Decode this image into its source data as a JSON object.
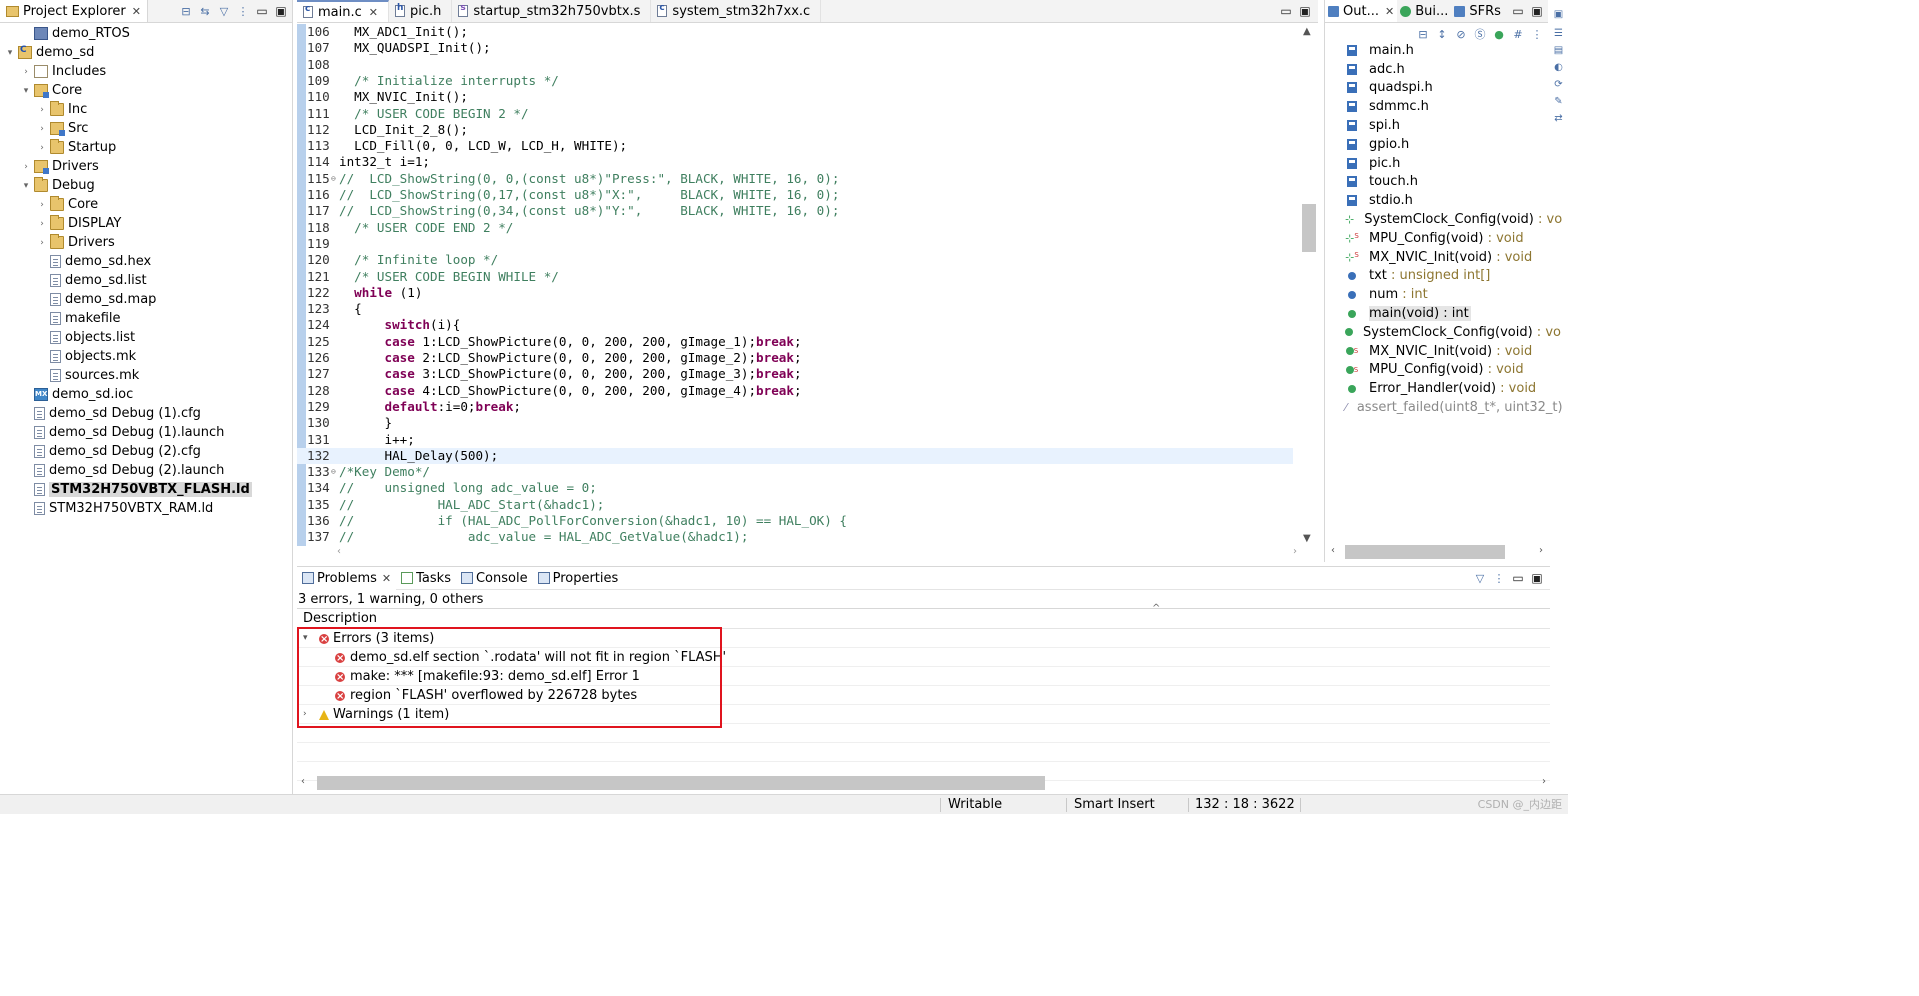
{
  "project_explorer": {
    "title": "Project Explorer",
    "items": [
      {
        "label": "demo_RTOS",
        "depth": 1,
        "twisty": "",
        "icon": "project"
      },
      {
        "label": "demo_sd",
        "depth": 0,
        "twisty": "▾",
        "icon": "project"
      },
      {
        "label": "Includes",
        "depth": 1,
        "twisty": "›",
        "icon": "include"
      },
      {
        "label": "Core",
        "depth": 1,
        "twisty": "▾",
        "icon": "srcfolder"
      },
      {
        "label": "Inc",
        "depth": 2,
        "twisty": "›",
        "icon": "folder"
      },
      {
        "label": "Src",
        "depth": 2,
        "twisty": "›",
        "icon": "srcfolder"
      },
      {
        "label": "Startup",
        "depth": 2,
        "twisty": "›",
        "icon": "folder"
      },
      {
        "label": "Drivers",
        "depth": 1,
        "twisty": "›",
        "icon": "srcfolder"
      },
      {
        "label": "Debug",
        "depth": 1,
        "twisty": "▾",
        "icon": "folder"
      },
      {
        "label": "Core",
        "depth": 2,
        "twisty": "›",
        "icon": "folder"
      },
      {
        "label": "DISPLAY",
        "depth": 2,
        "twisty": "›",
        "icon": "folder"
      },
      {
        "label": "Drivers",
        "depth": 2,
        "twisty": "›",
        "icon": "folder"
      },
      {
        "label": "demo_sd.hex",
        "depth": 2,
        "twisty": "",
        "icon": "file"
      },
      {
        "label": "demo_sd.list",
        "depth": 2,
        "twisty": "",
        "icon": "file"
      },
      {
        "label": "demo_sd.map",
        "depth": 2,
        "twisty": "",
        "icon": "file"
      },
      {
        "label": "makefile",
        "depth": 2,
        "twisty": "",
        "icon": "file"
      },
      {
        "label": "objects.list",
        "depth": 2,
        "twisty": "",
        "icon": "file"
      },
      {
        "label": "objects.mk",
        "depth": 2,
        "twisty": "",
        "icon": "file"
      },
      {
        "label": "sources.mk",
        "depth": 2,
        "twisty": "",
        "icon": "file"
      },
      {
        "label": "demo_sd.ioc",
        "depth": 1,
        "twisty": "",
        "icon": "mx"
      },
      {
        "label": "demo_sd Debug (1).cfg",
        "depth": 1,
        "twisty": "",
        "icon": "file"
      },
      {
        "label": "demo_sd Debug (1).launch",
        "depth": 1,
        "twisty": "",
        "icon": "file"
      },
      {
        "label": "demo_sd Debug (2).cfg",
        "depth": 1,
        "twisty": "",
        "icon": "file"
      },
      {
        "label": "demo_sd Debug (2).launch",
        "depth": 1,
        "twisty": "",
        "icon": "file"
      },
      {
        "label": "STM32H750VBTX_FLASH.ld",
        "depth": 1,
        "twisty": "",
        "icon": "file",
        "selected": true
      },
      {
        "label": "STM32H750VBTX_RAM.ld",
        "depth": 1,
        "twisty": "",
        "icon": "file"
      }
    ]
  },
  "editor": {
    "tabs": [
      {
        "label": "main.c",
        "active": true,
        "closable": true,
        "icon": "c"
      },
      {
        "label": "pic.h",
        "active": false,
        "closable": false,
        "icon": "h"
      },
      {
        "label": "startup_stm32h750vbtx.s",
        "active": false,
        "closable": false,
        "icon": "s"
      },
      {
        "label": "system_stm32h7xx.c",
        "active": false,
        "closable": false,
        "icon": "c"
      }
    ],
    "lines": [
      {
        "n": "106",
        "code": "  MX_ADC1_Init();",
        "kind": "plain"
      },
      {
        "n": "107",
        "code": "  MX_QUADSPI_Init();",
        "kind": "plain"
      },
      {
        "n": "108",
        "code": "",
        "kind": "plain"
      },
      {
        "n": "109",
        "code": "  /* Initialize interrupts */",
        "kind": "comment"
      },
      {
        "n": "110",
        "code": "  MX_NVIC_Init();",
        "kind": "plain"
      },
      {
        "n": "111",
        "code": "  /* USER CODE BEGIN 2 */",
        "kind": "comment"
      },
      {
        "n": "112",
        "code": "  LCD_Init_2_8();",
        "kind": "plain"
      },
      {
        "n": "113",
        "code": "  LCD_Fill(0, 0, LCD_W, LCD_H, WHITE);",
        "kind": "plain"
      },
      {
        "n": "114",
        "code": "int32_t i=1;",
        "kind": "plain"
      },
      {
        "n": "115",
        "code": "//  LCD_ShowString(0, 0,(const u8*)\"Press:\", BLACK, WHITE, 16, 0);",
        "kind": "comment",
        "fold": true
      },
      {
        "n": "116",
        "code": "//  LCD_ShowString(0,17,(const u8*)\"X:\",     BLACK, WHITE, 16, 0);",
        "kind": "comment"
      },
      {
        "n": "117",
        "code": "//  LCD_ShowString(0,34,(const u8*)\"Y:\",     BLACK, WHITE, 16, 0);",
        "kind": "comment"
      },
      {
        "n": "118",
        "code": "  /* USER CODE END 2 */",
        "kind": "comment"
      },
      {
        "n": "119",
        "code": "",
        "kind": "plain"
      },
      {
        "n": "120",
        "code": "  /* Infinite loop */",
        "kind": "comment"
      },
      {
        "n": "121",
        "code": "  /* USER CODE BEGIN WHILE */",
        "kind": "comment"
      },
      {
        "n": "122",
        "code": "  while (1)",
        "kind": "while"
      },
      {
        "n": "123",
        "code": "  {",
        "kind": "plain"
      },
      {
        "n": "124",
        "code": "      switch(i){",
        "kind": "switch"
      },
      {
        "n": "125",
        "code": "      case 1:LCD_ShowPicture(0, 0, 200, 200, gImage_1);break;",
        "kind": "case"
      },
      {
        "n": "126",
        "code": "      case 2:LCD_ShowPicture(0, 0, 200, 200, gImage_2);break;",
        "kind": "case"
      },
      {
        "n": "127",
        "code": "      case 3:LCD_ShowPicture(0, 0, 200, 200, gImage_3);break;",
        "kind": "case"
      },
      {
        "n": "128",
        "code": "      case 4:LCD_ShowPicture(0, 0, 200, 200, gImage_4);break;",
        "kind": "case"
      },
      {
        "n": "129",
        "code": "      default:i=0;break;",
        "kind": "default"
      },
      {
        "n": "130",
        "code": "      }",
        "kind": "plain"
      },
      {
        "n": "131",
        "code": "      i++;",
        "kind": "plain"
      },
      {
        "n": "132",
        "code": "      HAL_Delay(500);",
        "kind": "plain",
        "current": true
      },
      {
        "n": "133",
        "code": "/*Key Demo*/",
        "kind": "comment",
        "fold": true
      },
      {
        "n": "134",
        "code": "//    unsigned long adc_value = 0;",
        "kind": "comment"
      },
      {
        "n": "135",
        "code": "//           HAL_ADC_Start(&hadc1);",
        "kind": "comment"
      },
      {
        "n": "136",
        "code": "//           if (HAL_ADC_PollForConversion(&hadc1, 10) == HAL_OK) {",
        "kind": "comment"
      },
      {
        "n": "137",
        "code": "//               adc_value = HAL_ADC_GetValue(&hadc1);",
        "kind": "comment"
      }
    ]
  },
  "outline": {
    "tabs": [
      {
        "label": "Out...",
        "closable": true
      },
      {
        "label": "Bui...",
        "closable": false
      },
      {
        "label": "SFRs",
        "closable": false
      }
    ],
    "items": [
      {
        "name": "main.h",
        "type": "",
        "icon": "include"
      },
      {
        "name": "adc.h",
        "type": "",
        "icon": "include"
      },
      {
        "name": "quadspi.h",
        "type": "",
        "icon": "include"
      },
      {
        "name": "sdmmc.h",
        "type": "",
        "icon": "include"
      },
      {
        "name": "spi.h",
        "type": "",
        "icon": "include"
      },
      {
        "name": "gpio.h",
        "type": "",
        "icon": "include"
      },
      {
        "name": "pic.h",
        "type": "",
        "icon": "include"
      },
      {
        "name": "touch.h",
        "type": "",
        "icon": "include"
      },
      {
        "name": "stdio.h",
        "type": "",
        "icon": "include"
      },
      {
        "name": "SystemClock_Config(void)",
        "type": " : vo",
        "icon": "decl"
      },
      {
        "name": "MPU_Config(void)",
        "type": " : void",
        "icon": "decl-static"
      },
      {
        "name": "MX_NVIC_Init(void)",
        "type": " : void",
        "icon": "decl-static"
      },
      {
        "name": "txt",
        "type": " : unsigned int[]",
        "icon": "var"
      },
      {
        "name": "num",
        "type": " : int",
        "icon": "var"
      },
      {
        "name": "main(void)",
        "type": " : int",
        "icon": "func",
        "selected": true
      },
      {
        "name": "SystemClock_Config(void)",
        "type": " : vo",
        "icon": "func"
      },
      {
        "name": "MX_NVIC_Init(void)",
        "type": " : void",
        "icon": "func-static"
      },
      {
        "name": "MPU_Config(void)",
        "type": " : void",
        "icon": "func-static"
      },
      {
        "name": "Error_Handler(void)",
        "type": " : void",
        "icon": "func"
      },
      {
        "name": "assert_failed(uint8_t*, uint32_t)",
        "type": "",
        "icon": "disabled"
      }
    ]
  },
  "problems": {
    "tabs": [
      {
        "label": "Problems",
        "active": true,
        "closable": true
      },
      {
        "label": "Tasks",
        "active": false
      },
      {
        "label": "Console",
        "active": false
      },
      {
        "label": "Properties",
        "active": false
      }
    ],
    "summary": "3 errors, 1 warning, 0 others",
    "column_header": "Description",
    "groups": [
      {
        "label": "Errors (3 items)",
        "expanded": true,
        "severity": "error",
        "items": [
          "demo_sd.elf section `.rodata' will not fit in region `FLASH'",
          "make: *** [makefile:93: demo_sd.elf] Error 1",
          "region `FLASH' overflowed by 226728 bytes"
        ]
      },
      {
        "label": "Warnings (1 item)",
        "expanded": false,
        "severity": "warning",
        "items": []
      }
    ]
  },
  "statusbar": {
    "writable": "Writable",
    "insert_mode": "Smart Insert",
    "position": "132 : 18 : 3622",
    "watermark": "CSDN @_内边距"
  },
  "colors": {
    "error": "#d94040",
    "warning": "#e7b416",
    "highlight_box": "#e0141e",
    "keyword": "#7f0055",
    "comment": "#3f7f5f",
    "string": "#2a00ff"
  }
}
